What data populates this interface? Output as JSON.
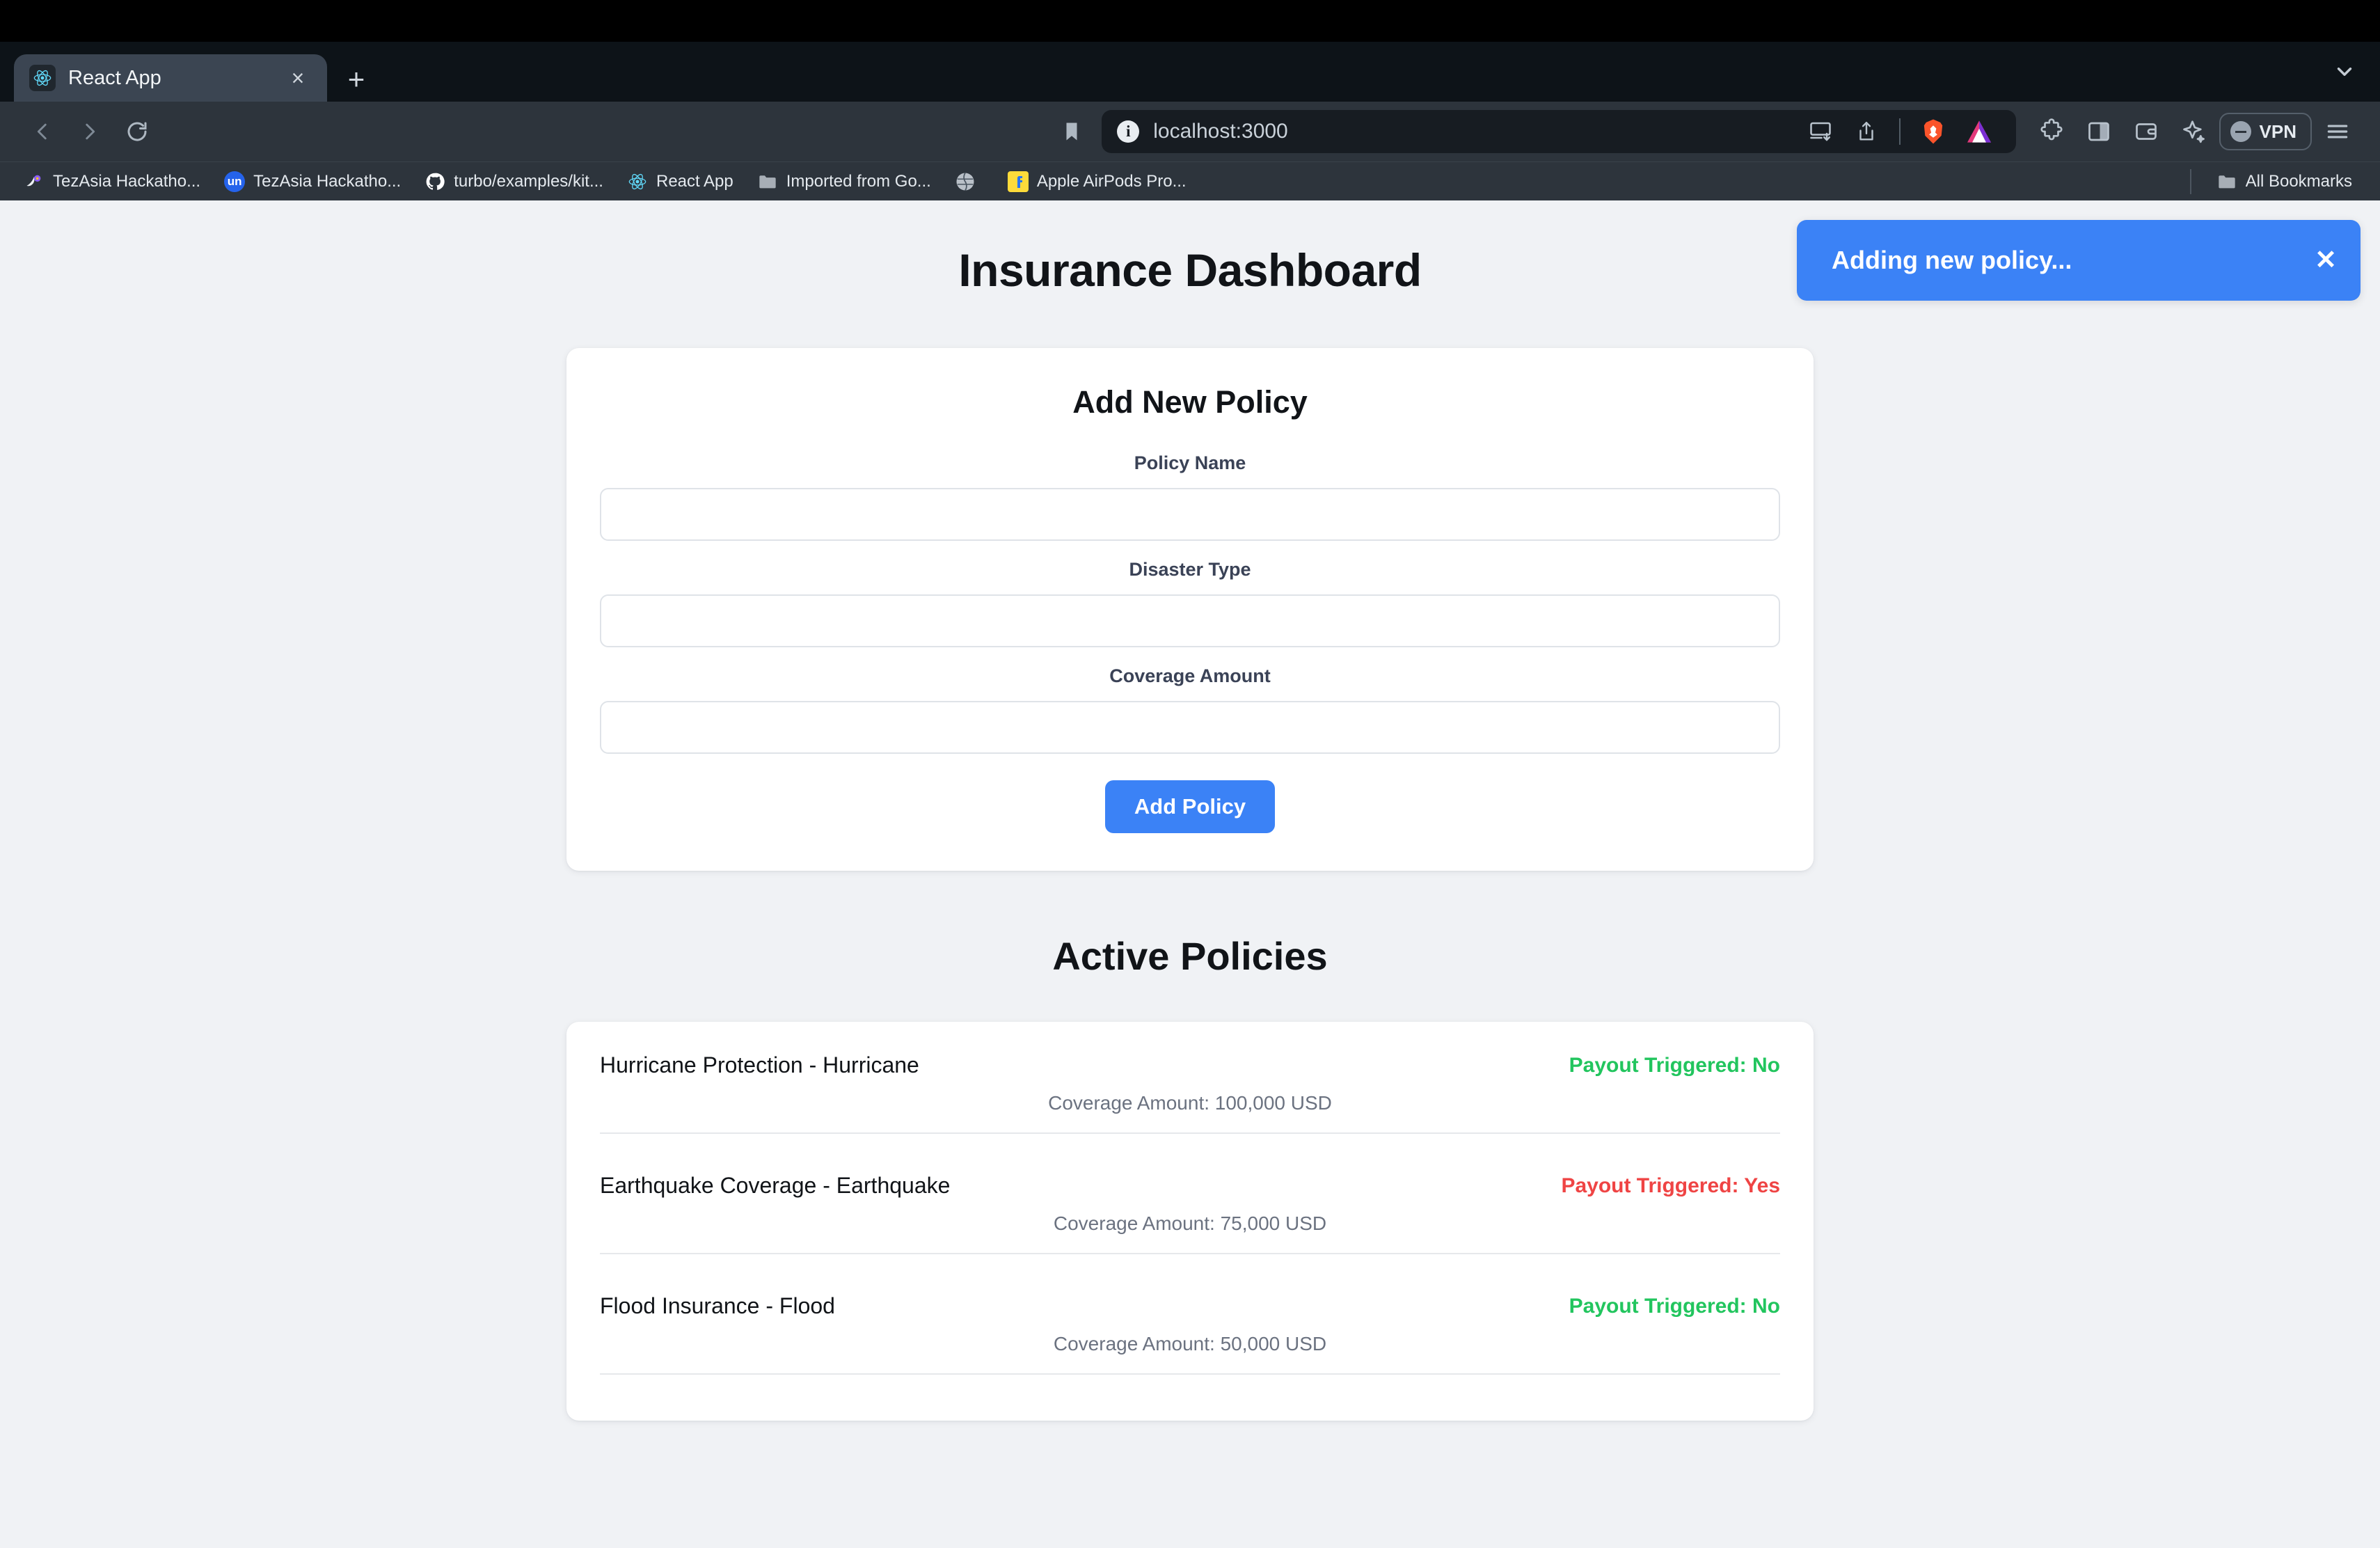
{
  "browser": {
    "tab": {
      "title": "React App",
      "favicon": "react-icon",
      "close_label": "×"
    },
    "new_tab_label": "+",
    "tab_search_icon": "chevron-down-icon",
    "nav": {
      "back_icon": "back-arrow-icon",
      "forward_icon": "forward-arrow-icon",
      "reload_icon": "reload-icon",
      "bookmark_icon": "bookmark-icon"
    },
    "address": {
      "security_icon": "info-icon",
      "url": "localhost:3000"
    },
    "toolbar_icons": [
      "cast-icon",
      "share-icon",
      "brave-lion-icon",
      "brave-rewards-triangle-icon",
      "extensions-puzzle-icon",
      "sidebar-panel-icon",
      "wallet-icon",
      "leo-sparkle-icon"
    ],
    "vpn": {
      "label": "VPN",
      "icon": "vpn-status-icon"
    },
    "menu_icon": "hamburger-menu-icon",
    "bookmarks": [
      {
        "label": "TezAsia Hackatho...",
        "icon": "tezasia-icon"
      },
      {
        "label": "TezAsia Hackatho...",
        "icon": "unstoppable-un-icon"
      },
      {
        "label": "turbo/examples/kit...",
        "icon": "github-icon"
      },
      {
        "label": "React App",
        "icon": "react-icon"
      },
      {
        "label": "Imported from Go...",
        "icon": "folder-icon"
      },
      {
        "label": "",
        "icon": "globe-icon"
      },
      {
        "label": "Apple AirPods Pro...",
        "icon": "flipkart-icon"
      }
    ],
    "all_bookmarks": {
      "label": "All Bookmarks",
      "icon": "folder-icon"
    }
  },
  "toast": {
    "message": "Adding new policy...",
    "close_label": "✕",
    "color": "#3b82f6"
  },
  "page": {
    "title": "Insurance Dashboard",
    "form": {
      "heading": "Add New Policy",
      "fields": [
        {
          "label": "Policy Name",
          "value": "",
          "placeholder": ""
        },
        {
          "label": "Disaster Type",
          "value": "",
          "placeholder": ""
        },
        {
          "label": "Coverage Amount",
          "value": "",
          "placeholder": ""
        }
      ],
      "submit_label": "Add Policy",
      "submit_color": "#3b82f6"
    },
    "policies_heading": "Active Policies",
    "policies": [
      {
        "name": "Hurricane Protection - Hurricane",
        "coverage": "Coverage Amount: 100,000 USD",
        "status": "Payout Triggered: No",
        "status_color": "#22c55e"
      },
      {
        "name": "Earthquake Coverage - Earthquake",
        "coverage": "Coverage Amount: 75,000 USD",
        "status": "Payout Triggered: Yes",
        "status_color": "#ef4444"
      },
      {
        "name": "Flood Insurance - Flood",
        "coverage": "Coverage Amount: 50,000 USD",
        "status": "Payout Triggered: No",
        "status_color": "#22c55e"
      }
    ]
  }
}
